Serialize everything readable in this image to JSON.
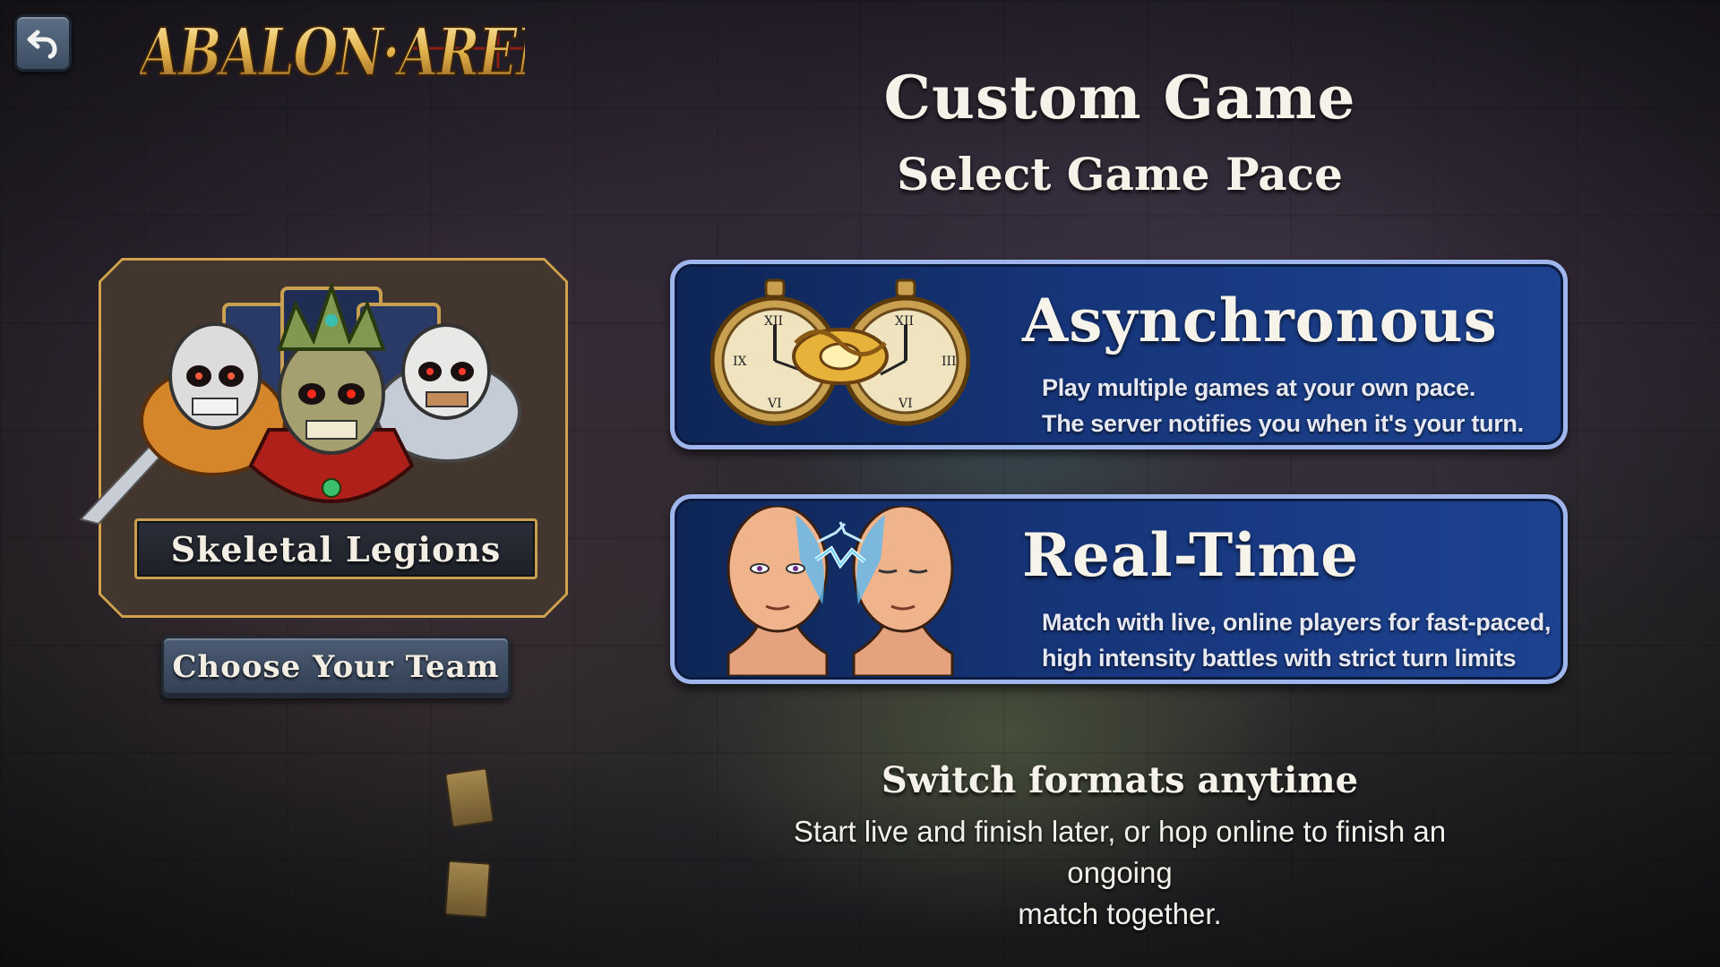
{
  "logo": {
    "text": "ABALON ARENA"
  },
  "back_button": {
    "icon": "back-arrow-icon"
  },
  "header": {
    "title": "Custom Game",
    "subtitle": "Select Game Pace"
  },
  "team": {
    "name": "Skeletal Legions",
    "choose_label": "Choose Your Team"
  },
  "modes": [
    {
      "title": "Asynchronous",
      "desc_line1": "Play multiple games at your own pace.",
      "desc_line2": "The server notifies you when it's your turn.",
      "icon": "pocket-watches-icon"
    },
    {
      "title": "Real-Time",
      "desc_line1": "Match with live, online players for fast-paced,",
      "desc_line2": "high intensity battles with strict turn limits",
      "icon": "linked-heads-icon"
    }
  ],
  "footer": {
    "title": "Switch formats anytime",
    "desc_line1": "Start live and finish later, or hop online to finish an ongoing",
    "desc_line2": "match together."
  },
  "colors": {
    "gold": "#d0a24c",
    "mode_blue": "#16357a",
    "mode_border": "#9fb6ec",
    "text_light": "#f5f2ea"
  }
}
